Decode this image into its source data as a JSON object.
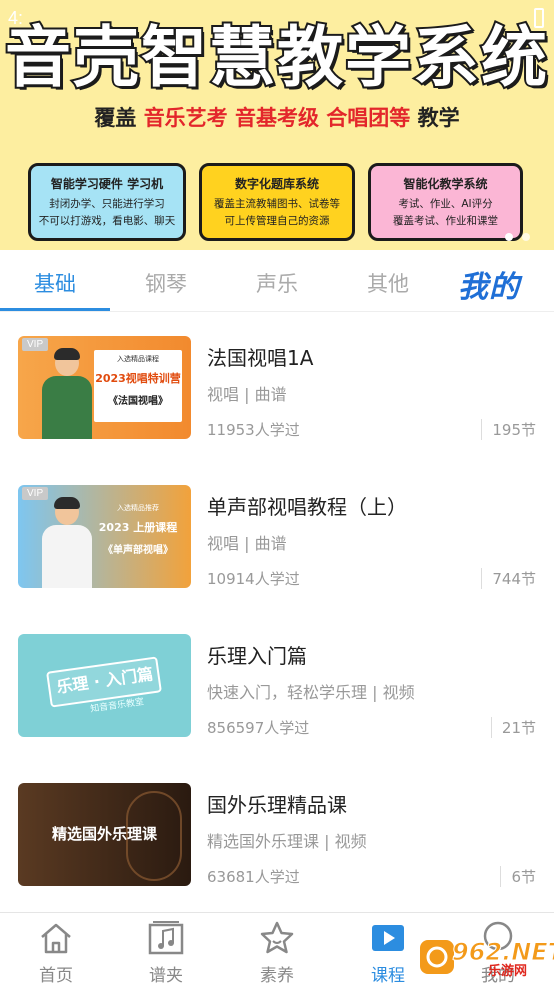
{
  "status_bar": {
    "time": "4:"
  },
  "banner": {
    "title": "音壳智慧教学系统",
    "subtitle_prefix": "覆盖",
    "subtitle_highlight": "音乐艺考 音基考级 合唱团等",
    "subtitle_suffix": "教学",
    "features": [
      {
        "title": "智能学习硬件 学习机",
        "line1": "封闭办学、只能进行学习",
        "line2": "不可以打游戏，看电影、聊天"
      },
      {
        "title": "数字化题库系统",
        "line1": "覆盖主流教辅图书、试卷等",
        "line2": "可上传管理自己的资源"
      },
      {
        "title": "智能化教学系统",
        "line1": "考试、作业、AI评分",
        "line2": "覆盖考试、作业和课堂"
      }
    ]
  },
  "tabs": [
    {
      "label": "基础",
      "active": true
    },
    {
      "label": "钢琴"
    },
    {
      "label": "声乐"
    },
    {
      "label": "其他"
    },
    {
      "label": "我的"
    }
  ],
  "courses": [
    {
      "title": "法国视唱1A",
      "tags": "视唱 | 曲谱",
      "learners": "11953人学过",
      "lessons": "195节",
      "thumb": {
        "vip": "VIP",
        "line1": "入选精品课程",
        "line2": "2023视唱特训营",
        "line3": "《法国视唱》"
      }
    },
    {
      "title": "单声部视唱教程（上）",
      "tags": "视唱 | 曲谱",
      "learners": "10914人学过",
      "lessons": "744节",
      "thumb": {
        "vip": "VIP",
        "line1": "入选精品推荐",
        "line2": "2023 上册课程",
        "line3": "《单声部视唱》"
      }
    },
    {
      "title": "乐理入门篇",
      "tags": "快速入门，轻松学乐理 | 视频",
      "learners": "856597人学过",
      "lessons": "21节",
      "thumb": {
        "text": "乐理 · 入门篇",
        "sub": "知音音乐教室"
      }
    },
    {
      "title": "国外乐理精品课",
      "tags": "精选国外乐理课 | 视频",
      "learners": "63681人学过",
      "lessons": "6节",
      "thumb": {
        "text": "精选国外乐理课"
      }
    }
  ],
  "bottom_nav": [
    {
      "label": "首页",
      "icon": "home-icon"
    },
    {
      "label": "谱夹",
      "icon": "music-folder-icon"
    },
    {
      "label": "素养",
      "icon": "star-icon"
    },
    {
      "label": "课程",
      "icon": "play-icon",
      "active": true
    },
    {
      "label": "我的",
      "icon": "profile-icon"
    }
  ],
  "watermark": {
    "text": "962.NET",
    "sub": "乐游网"
  },
  "colors": {
    "accent": "#2c8de0",
    "banner_bg": "#fdeea0",
    "highlight_red": "#e3262b"
  }
}
